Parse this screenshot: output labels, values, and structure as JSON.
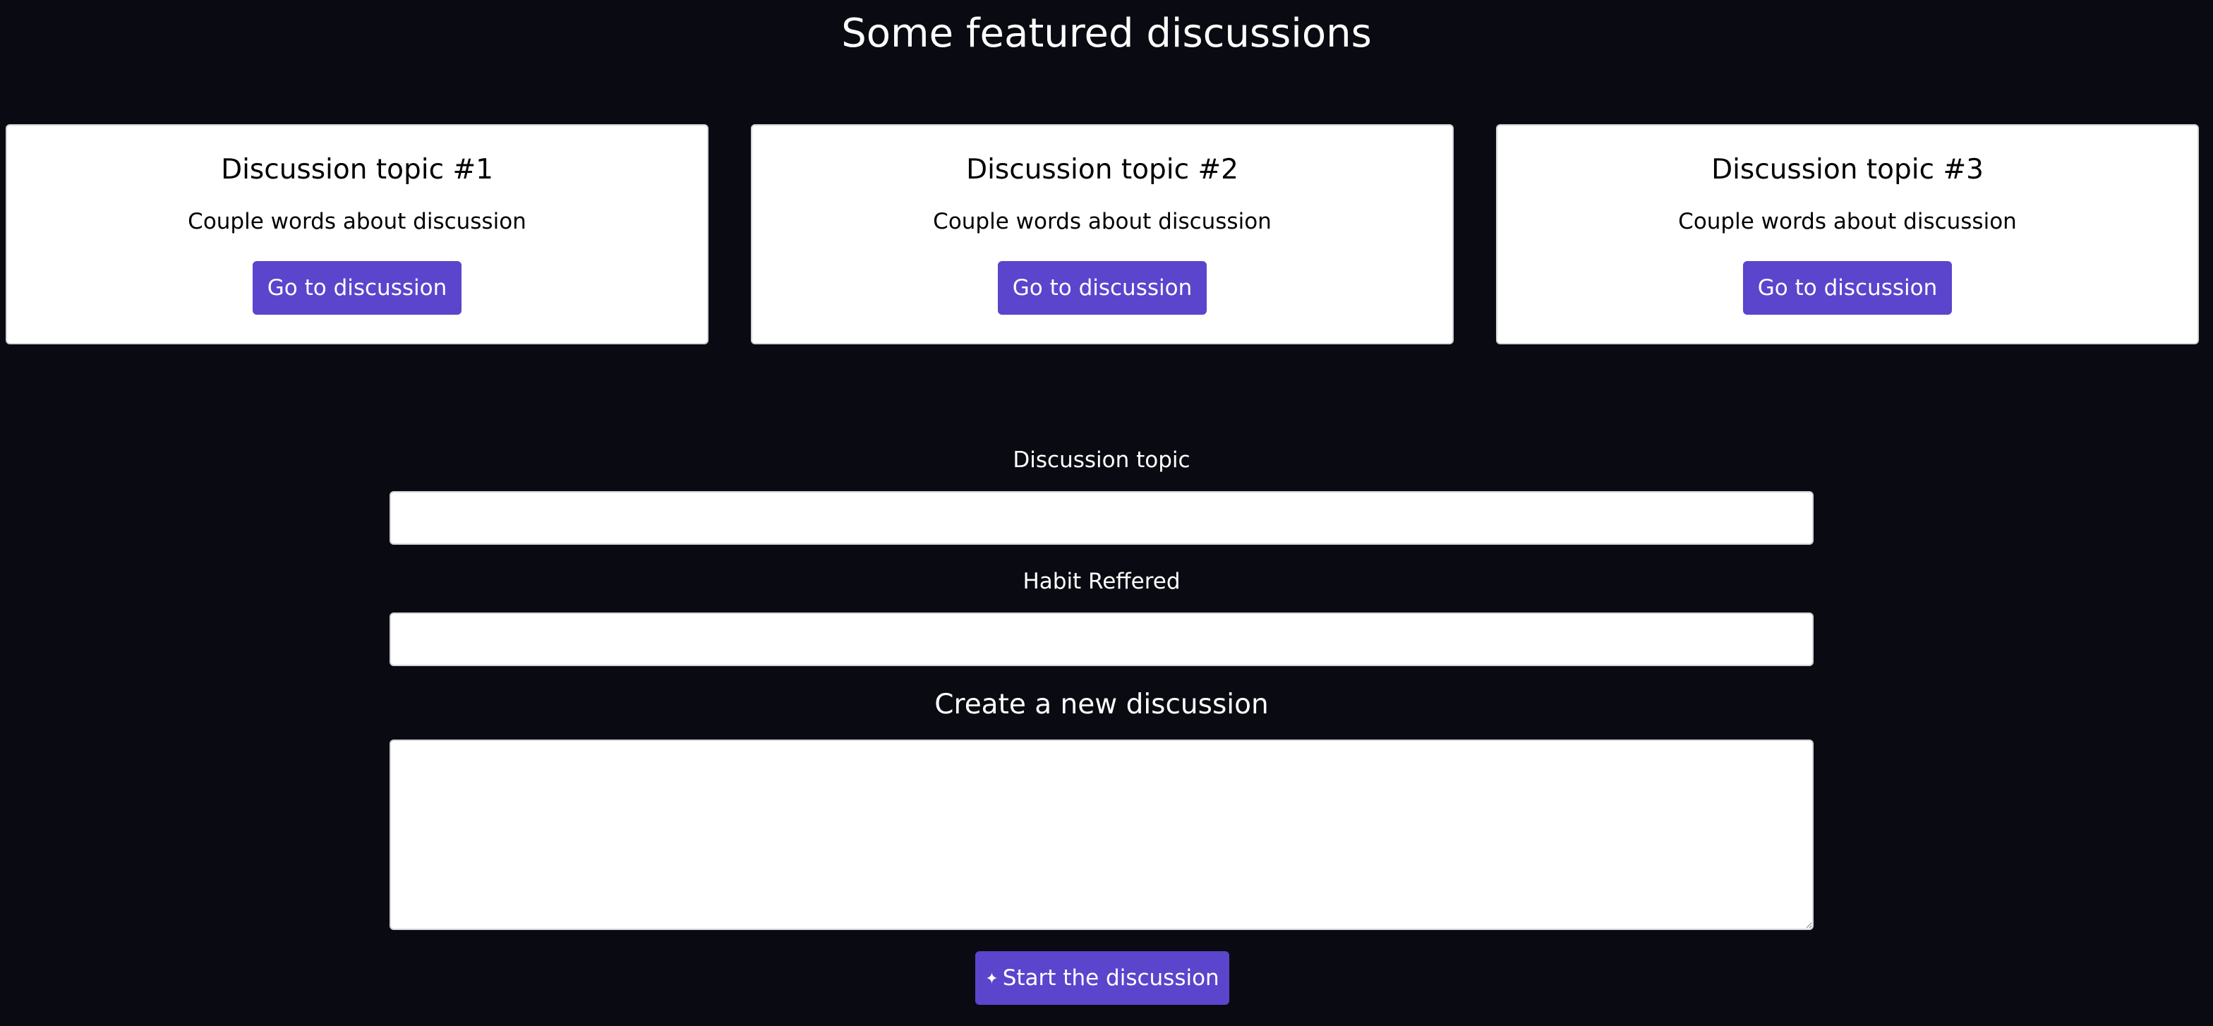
{
  "header": {
    "title": "Some featured discussions"
  },
  "cards": [
    {
      "title": "Discussion topic #1",
      "text": "Couple words about discussion",
      "button_label": "Go to discussion"
    },
    {
      "title": "Discussion topic #2",
      "text": "Couple words about discussion",
      "button_label": "Go to discussion"
    },
    {
      "title": "Discussion topic #3",
      "text": "Couple words about discussion",
      "button_label": "Go to discussion"
    }
  ],
  "form": {
    "topic_label": "Discussion topic",
    "topic_value": "",
    "habit_label": "Habit Reffered",
    "habit_value": "",
    "create_label": "Create a new discussion",
    "body_value": "",
    "submit_icon": "plus-icon",
    "submit_label": "Start the discussion"
  },
  "colors": {
    "background": "#0a0a12",
    "accent": "#5b45cc",
    "card": "#ffffff"
  }
}
